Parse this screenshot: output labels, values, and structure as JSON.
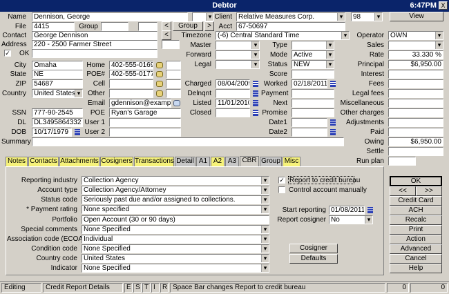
{
  "window": {
    "title": "Debtor",
    "clock": "6:47PM",
    "close": "X"
  },
  "left": {
    "name_label": "Name",
    "name": "Dennison, George",
    "file_label": "File",
    "file": "4415",
    "group_label": "Group",
    "group": "",
    "prev_btn": "<",
    "group_btn": "Group",
    "next_btn": ">",
    "contact_label": "Contact",
    "contact": "George Dennison",
    "address_label": "Address",
    "address": "220 - 2500 Farmer Street",
    "ok_check": "✓",
    "ok_label": "OK",
    "city_label": "City",
    "city": "Omaha",
    "state_label": "State",
    "state": "NE",
    "zip_label": "ZIP",
    "zip": "54687",
    "country_label": "Country",
    "country": "United States",
    "ssn_label": "SSN",
    "ssn": "777-90-2545",
    "dl_label": "DL",
    "dl": "DL3495864332",
    "dob_label": "DOB",
    "dob": "10/17/1979",
    "summary_label": "Summary",
    "summary": ""
  },
  "phones": {
    "home_label": "Home",
    "home": "402-555-0169",
    "poe_num_label": "POE#",
    "poe_num": "402-555-0177",
    "cell_label": "Cell",
    "cell": "",
    "other_label": "Other",
    "other": "",
    "email_label": "Email",
    "email": "gdennison@example.r",
    "poe_label": "POE",
    "poe": "Ryan's Garage",
    "user1_label": "User 1",
    "user1": "",
    "user2_label": "User 2",
    "user2": ""
  },
  "middle": {
    "client_label": "Client",
    "client": "Relative Measures Corp.",
    "client_code": "98",
    "view_btn": "View",
    "acct_label": "Acct",
    "acct": "67-50697",
    "timezone_label": "Timezone",
    "timezone": "(-6) Central Standard Time",
    "master_label": "Master",
    "forward_label": "Forward",
    "legal_label": "Legal",
    "charged_label": "Charged",
    "charged": "08/04/2009",
    "delnqnt_label": "Delnqnt",
    "delnqnt": "",
    "listed_label": "Listed",
    "listed": "11/01/2010",
    "closed_label": "Closed",
    "closed": "",
    "type_label": "Type",
    "mode_label": "Mode",
    "mode": "Active",
    "status_label": "Status",
    "status": "NEW",
    "score_label": "Score",
    "worked_label": "Worked",
    "worked": "02/18/2011",
    "payment_label": "Payment",
    "next_label": "Next",
    "promise_label": "Promise",
    "date1_label": "Date1",
    "date2_label": "Date2"
  },
  "right": {
    "operator_label": "Operator",
    "operator": "OWN",
    "sales_label": "Sales",
    "sales": "",
    "rate_label": "Rate",
    "rate": "33.330 %",
    "principal_label": "Principal",
    "principal": "$6,950.00",
    "interest_label": "Interest",
    "interest": "",
    "fees_label": "Fees",
    "fees": "",
    "legal_fees_label": "Legal fees",
    "legal_fees": "",
    "misc_label": "Miscellaneous",
    "misc": "",
    "other_charges_label": "Other charges",
    "other_charges": "",
    "adjustments_label": "Adjustments",
    "adjustments": "",
    "paid_label": "Paid",
    "paid": "",
    "owing_label": "Owing",
    "owing": "$6,950.00",
    "settle_label": "Settle",
    "settle": "",
    "run_plan_label": "Run plan",
    "run_plan": ""
  },
  "tabs": [
    "Notes",
    "Contacts",
    "Attachments",
    "Cosigners",
    "Transactions",
    "Detail",
    "A1",
    "A2",
    "A3",
    "CBR",
    "Group",
    "Misc"
  ],
  "cbr": {
    "reporting_industry_label": "Reporting industry",
    "reporting_industry": "Collection Agency",
    "account_type_label": "Account type",
    "account_type": "Collection Agency/Attorney",
    "status_code_label": "Status code",
    "status_code": "Seriously past due and/or assigned to collections.",
    "payment_rating_label": "* Payment rating",
    "payment_rating": "None specified",
    "portfolio_label": "Portfolio",
    "portfolio": "Open Account (30 or 90 days)",
    "special_comments_label": "Special comments",
    "special_comments": "None Specified",
    "ecoa_label": "Association code (ECOA)",
    "ecoa": "Individual",
    "condition_code_label": "Condition code",
    "condition_code": "None Specified",
    "country_code_label": "Country code",
    "country_code": "United States",
    "indicator_label": "Indicator",
    "indicator": "None Specified",
    "report_to_bureau_label": "Report to credit bureau",
    "report_to_bureau_check": "✓",
    "control_manually_label": "Control account manually",
    "start_reporting_label": "Start reporting",
    "start_reporting": "01/08/2011",
    "report_cosigner_label": "Report cosigner",
    "report_cosigner": "No",
    "cosigner_btn": "Cosigner",
    "defaults_btn": "Defaults"
  },
  "actions": {
    "ok": "OK",
    "prev": "<<",
    "next": ">>",
    "credit_card": "Credit Card",
    "ach": "ACH",
    "recalc": "Recalc",
    "print": "Print",
    "action": "Action",
    "advanced": "Advanced",
    "cancel": "Cancel",
    "help": "Help"
  },
  "statusbar": {
    "mode": "Editing",
    "section": "Credit Report Details",
    "keys": [
      "E",
      "S",
      "T",
      "I",
      "R"
    ],
    "hint": "Space Bar changes Report to credit bureau",
    "count1": "0",
    "count2": "0"
  }
}
